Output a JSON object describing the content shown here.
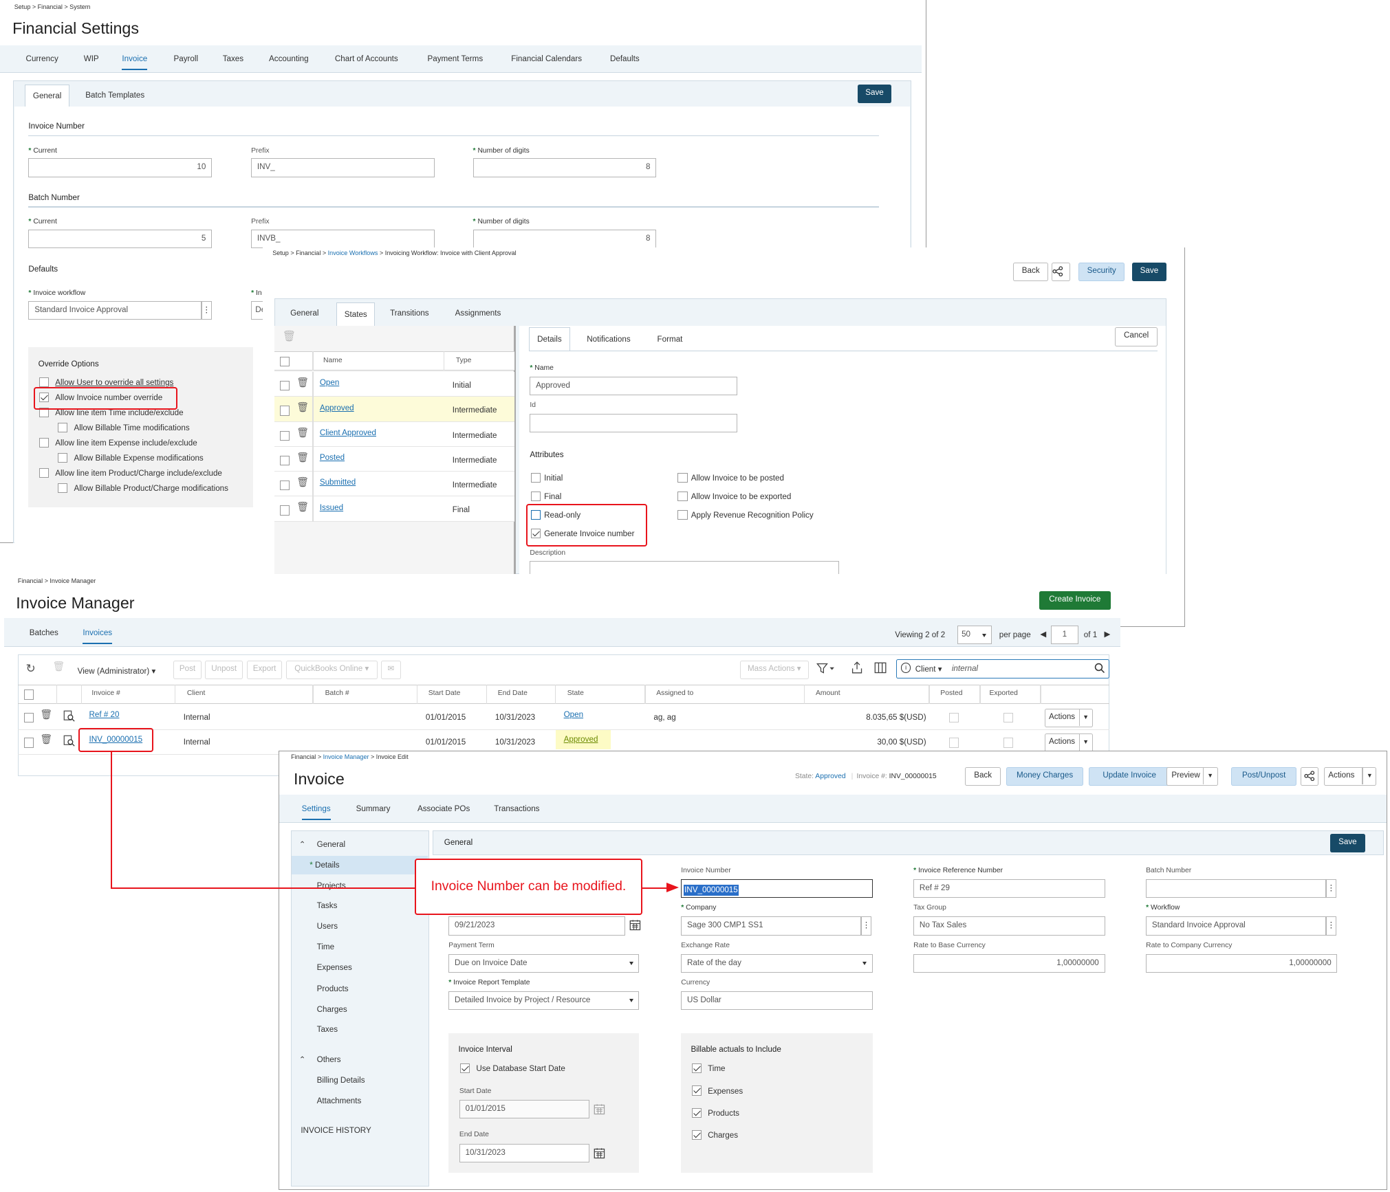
{
  "fin": {
    "breadcrumb": "Setup > Financial > System",
    "title": "Financial Settings",
    "tabs": [
      "Currency",
      "WIP",
      "Invoice",
      "Payroll",
      "Taxes",
      "Accounting",
      "Chart of Accounts",
      "Payment Terms",
      "Financial Calendars",
      "Defaults"
    ],
    "subtabs": [
      "General",
      "Batch Templates"
    ],
    "save": "Save",
    "invoice_number": {
      "heading": "Invoice Number",
      "current_label": "Current",
      "current": "10",
      "prefix_label": "Prefix",
      "prefix": "INV_",
      "digits_label": "Number of digits",
      "digits": "8"
    },
    "batch_number": {
      "heading": "Batch Number",
      "current_label": "Current",
      "current": "5",
      "prefix_label": "Prefix",
      "prefix": "INVB_",
      "digits_label": "Number of digits",
      "digits": "8"
    },
    "defaults": {
      "heading": "Defaults",
      "workflow_label": "Invoice workflow",
      "workflow": "Standard Invoice Approval",
      "second_label": "In",
      "second_value": "De"
    },
    "override": {
      "heading": "Override Options",
      "items": [
        {
          "label": "Allow User to override all settings",
          "checked": false
        },
        {
          "label": "Allow Invoice number override",
          "checked": true
        },
        {
          "label": "Allow line item Time include/exclude",
          "checked": false
        },
        {
          "label": "Allow Billable Time modifications",
          "checked": false
        },
        {
          "label": "Allow line item Expense include/exclude",
          "checked": false
        },
        {
          "label": "Allow Billable Expense modifications",
          "checked": false
        },
        {
          "label": "Allow line item Product/Charge include/exclude",
          "checked": false
        },
        {
          "label": "Allow Billable Product/Charge modifications",
          "checked": false
        }
      ]
    }
  },
  "wf": {
    "breadcrumb_pre": "Setup > Financial > ",
    "breadcrumb_link": "Invoice Workflows",
    "breadcrumb_post": " > Invoicing Workflow: Invoice with Client Approval",
    "back": "Back",
    "security": "Security",
    "save": "Save",
    "tabs": [
      "General",
      "States",
      "Transitions",
      "Assignments"
    ],
    "cols": [
      "Name",
      "Type"
    ],
    "states": [
      {
        "name": "Open",
        "type": "Initial"
      },
      {
        "name": "Approved",
        "type": "Intermediate"
      },
      {
        "name": "Client Approved",
        "type": "Intermediate"
      },
      {
        "name": "Posted",
        "type": "Intermediate"
      },
      {
        "name": "Submitted",
        "type": "Intermediate"
      },
      {
        "name": "Issued",
        "type": "Final"
      }
    ],
    "detail_tabs": [
      "Details",
      "Notifications",
      "Format"
    ],
    "cancel": "Cancel",
    "name_label": "Name",
    "name": "Approved",
    "id_label": "Id",
    "id": "",
    "attributes": "Attributes",
    "attrs_left": [
      {
        "label": "Initial",
        "checked": false
      },
      {
        "label": "Final",
        "checked": false
      },
      {
        "label": "Read-only",
        "checked": false
      },
      {
        "label": "Generate Invoice number",
        "checked": true
      }
    ],
    "attrs_right": [
      {
        "label": "Allow Invoice to be posted"
      },
      {
        "label": "Allow Invoice to be exported"
      },
      {
        "label": "Apply Revenue Recognition Policy"
      }
    ],
    "description_label": "Description"
  },
  "im": {
    "breadcrumb": "Financial > Invoice Manager",
    "title": "Invoice Manager",
    "create": "Create Invoice",
    "tabs": [
      "Batches",
      "Invoices"
    ],
    "viewing_label": "Viewing",
    "viewing": "2 of 2",
    "per_page_value": "50",
    "per_page": "per page",
    "page": "1",
    "of_pages": "of 1",
    "toolbar": {
      "view": "View (Administrator)",
      "post": "Post",
      "unpost": "Unpost",
      "export": "Export",
      "qb": "QuickBooks Online",
      "mass": "Mass Actions",
      "client": "Client",
      "search": "internal"
    },
    "cols": [
      "Invoice #",
      "Client",
      "Batch #",
      "Start Date",
      "End Date",
      "State",
      "Assigned to",
      "Amount",
      "Posted",
      "Exported"
    ],
    "rows": [
      {
        "inv": "Ref # 20",
        "client": "Internal",
        "batch": "",
        "start": "01/01/2015",
        "end": "10/31/2023",
        "state": "Open",
        "assigned": "ag, ag",
        "amount": "8.035,65 $(USD)",
        "actions": "Actions"
      },
      {
        "inv": "INV_00000015",
        "client": "Internal",
        "batch": "",
        "start": "01/01/2015",
        "end": "10/31/2023",
        "state": "Approved",
        "assigned": "",
        "amount": "30,00 $(USD)",
        "actions": "Actions"
      }
    ]
  },
  "inv": {
    "breadcrumb_pre": "Financial > ",
    "breadcrumb_link": "Invoice Manager",
    "breadcrumb_post": " > Invoice Edit",
    "title": "Invoice",
    "state_label": "State:",
    "state": "Approved",
    "invno_label": "Invoice #:",
    "invno": "INV_00000015",
    "buttons": {
      "back": "Back",
      "money": "Money Charges",
      "update": "Update Invoice",
      "preview": "Preview",
      "post": "Post/Unpost",
      "actions": "Actions"
    },
    "tabs": [
      "Settings",
      "Summary",
      "Associate POs",
      "Transactions"
    ],
    "nav": {
      "general": "General",
      "items": [
        "Details",
        "Projects",
        "Tasks",
        "Users",
        "Time",
        "Expenses",
        "Products",
        "Charges",
        "Taxes"
      ],
      "others": "Others",
      "others_items": [
        "Billing Details",
        "Attachments"
      ],
      "history": "INVOICE HISTORY"
    },
    "section": "General",
    "save": "Save",
    "fields": {
      "invoice_number_label": "Invoice Number",
      "invoice_number": "INV_00000015",
      "ref_label": "Invoice Reference Number",
      "ref": "Ref # 29",
      "batch_label": "Batch Number",
      "batch": "",
      "date": "09/21/2023",
      "company_label": "Company",
      "company": "Sage 300 CMP1 SS1",
      "taxgroup_label": "Tax Group",
      "taxgroup": "No Tax Sales",
      "workflow_label": "Workflow",
      "workflow": "Standard Invoice Approval",
      "payterm_label": "Payment Term",
      "payterm": "Due on Invoice Date",
      "exrate_label": "Exchange Rate",
      "exrate": "Rate of the day",
      "base_label": "Rate to Base Currency",
      "base": "1,00000000",
      "comp_label": "Rate to Company Currency",
      "comp": "1,00000000",
      "template_label": "Invoice Report Template",
      "template": "Detailed Invoice by Project / Resource",
      "currency_label": "Currency",
      "currency": "US Dollar"
    },
    "interval": {
      "heading": "Invoice Interval",
      "use_db": "Use Database Start Date",
      "start_label": "Start Date",
      "start": "01/01/2015",
      "end_label": "End Date",
      "end": "10/31/2023"
    },
    "billable": {
      "heading": "Billable actuals to Include",
      "items": [
        "Time",
        "Expenses",
        "Products",
        "Charges"
      ]
    }
  },
  "callout": "Invoice Number can be modified.",
  "colors": {
    "accent": "#1a6fb0",
    "dark_button": "#174a67",
    "green_button": "#1f7a36",
    "highlight": "#e8141c"
  }
}
